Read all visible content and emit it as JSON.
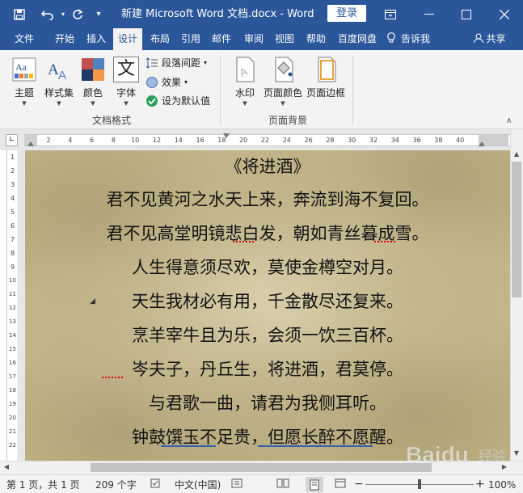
{
  "titlebar": {
    "title": "新建 Microsoft Word 文档.docx  -  Word",
    "login": "登录",
    "customize_icon": "▾"
  },
  "tabs": [
    {
      "label": "文件"
    },
    {
      "label": "开始"
    },
    {
      "label": "插入"
    },
    {
      "label": "设计",
      "active": true
    },
    {
      "label": "布局"
    },
    {
      "label": "引用"
    },
    {
      "label": "邮件"
    },
    {
      "label": "审阅"
    },
    {
      "label": "视图"
    },
    {
      "label": "帮助"
    },
    {
      "label": "百度网盘"
    },
    {
      "label": "告诉我"
    },
    {
      "label": "共享"
    }
  ],
  "ribbon": {
    "doc_format": {
      "theme": "主题",
      "style_set": "样式集",
      "colors": "颜色",
      "fonts": "字体",
      "fonts_glyph": "文",
      "paragraph_spacing": "段落间距",
      "effects": "效果",
      "set_default": "设为默认值",
      "group_label": "文档格式"
    },
    "page_bg": {
      "watermark": "水印",
      "page_color": "页面颜色",
      "page_borders": "页面边框",
      "group_label": "页面背景"
    }
  },
  "ruler": {
    "h_numbers": [
      "2",
      "4",
      "6",
      "8",
      "10",
      "12",
      "14",
      "16",
      "18",
      "20",
      "22",
      "24",
      "26",
      "28",
      "30",
      "32",
      "34",
      "36",
      "38",
      "40"
    ],
    "v_numbers": [
      "1",
      "2",
      "3",
      "4",
      "5",
      "6",
      "7",
      "8",
      "9",
      "10",
      "11",
      "12",
      "13",
      "14",
      "15",
      "16",
      "17",
      "18",
      "19",
      "20",
      "21",
      "22"
    ]
  },
  "document": {
    "title_line": "《将进酒》",
    "lines": [
      "君不见黄河之水天上来，奔流到海不复回。",
      "君不见高堂明镜悲白发，朝如青丝暮成雪。",
      "人生得意须尽欢，莫使金樽空对月。",
      "天生我材必有用，千金散尽还复来。",
      "烹羊宰牛且为乐，会须一饮三百杯。",
      "岑夫子，丹丘生，将进酒，君莫停。",
      "与君歌一曲，请君为我侧耳听。",
      "钟鼓馔玉不足贵，但愿长醉不愿醒。"
    ]
  },
  "statusbar": {
    "pages": "第 1 页，共 1 页",
    "words": "209 个字",
    "language": "中文(中国)",
    "zoom": "100%",
    "zoom_level": 1.0
  },
  "watermark_text": "Baidu 经验",
  "colors": {
    "accent": "#2b579a",
    "ribbon_bg": "#f3f3f3",
    "spell_error": "#d00000",
    "grammar": "#3b5fb0"
  }
}
